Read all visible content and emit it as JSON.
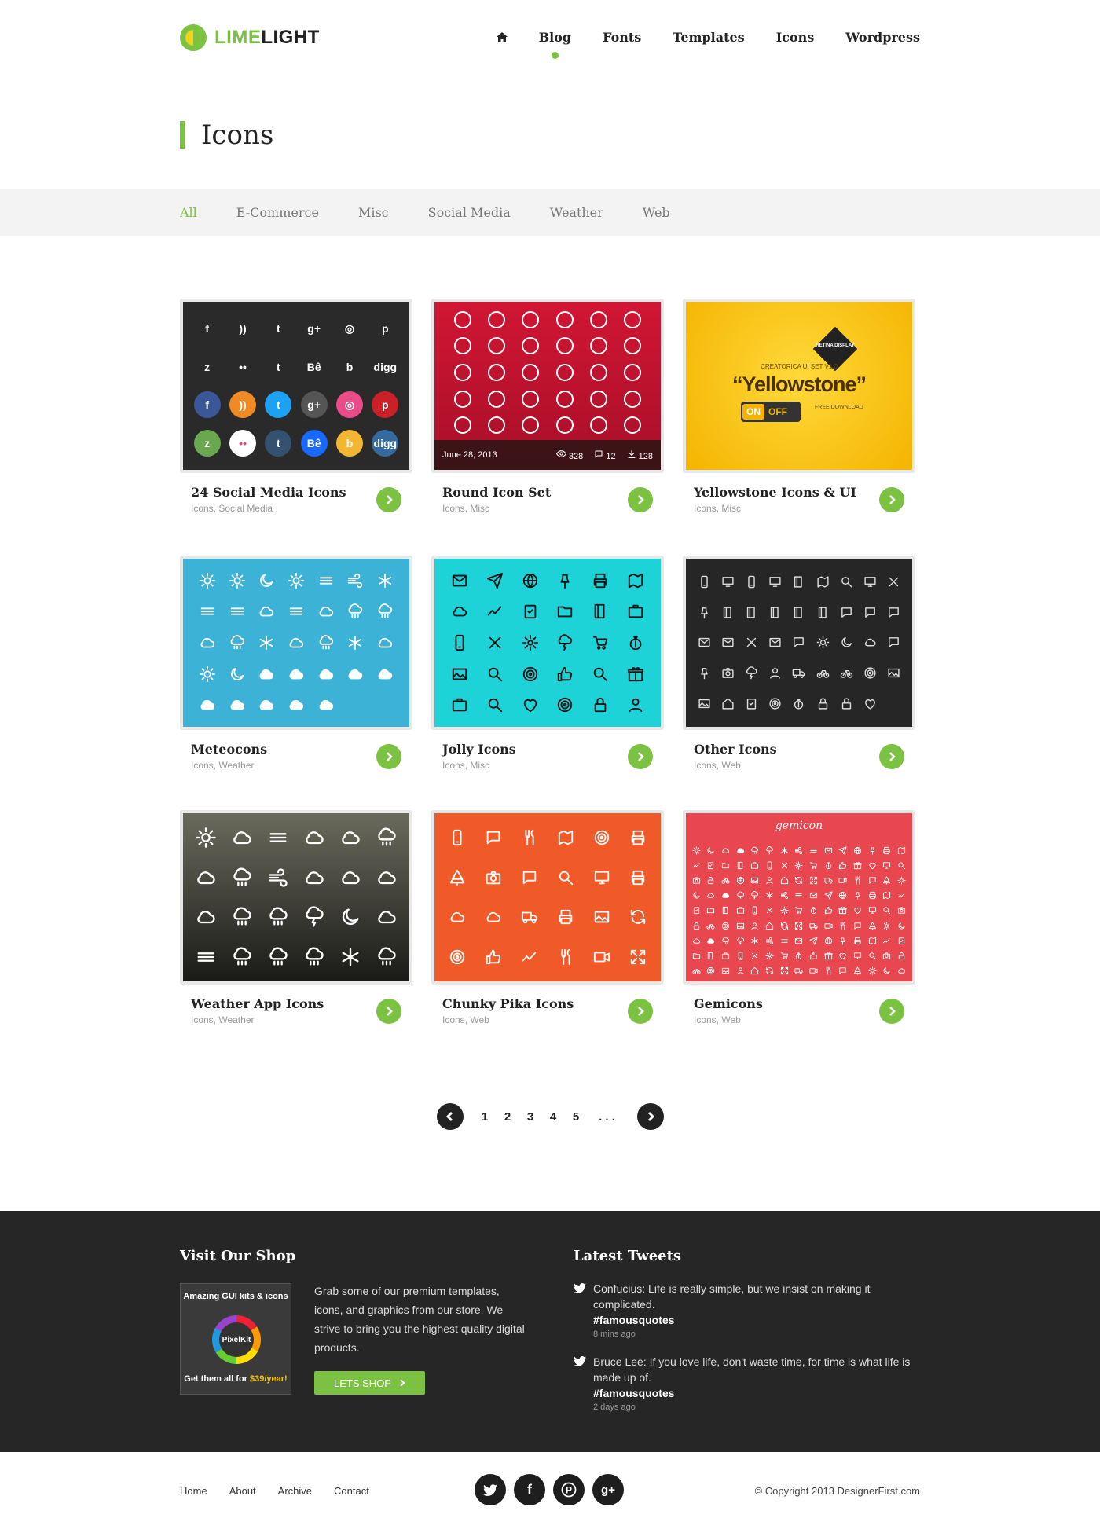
{
  "brand": {
    "part1": "LIME",
    "part2": "LIGHT",
    "accent": "#7cc242"
  },
  "nav": {
    "items": [
      "Blog",
      "Fonts",
      "Templates",
      "Icons",
      "Wordpress"
    ],
    "active": "Blog",
    "home_icon": "home-icon"
  },
  "page": {
    "title": "Icons"
  },
  "filters": {
    "items": [
      "All",
      "E-Commerce",
      "Misc",
      "Social Media",
      "Weather",
      "Web"
    ],
    "active": "All"
  },
  "cards": [
    {
      "title": "24 Social Media Icons",
      "tags": "Icons, Social Media",
      "bg": "#2a2a2a"
    },
    {
      "title": "Round Icon Set",
      "tags": "Icons, Misc",
      "bg": "#c5102c",
      "meta": {
        "date": "June 28, 2013",
        "views": "328",
        "comments": "12",
        "downloads": "128"
      }
    },
    {
      "title": "Yellowstone Icons & UI",
      "tags": "Icons, Misc",
      "bg": "#fcc300",
      "banner": {
        "pre": "CREATORICA UI SET V1.0",
        "name": "“Yellowstone”",
        "badge": "RETINA DISPLAY",
        "toggle_on": "ON",
        "toggle_off": "OFF",
        "free": "FREE DOWNLOAD"
      }
    },
    {
      "title": "Meteocons",
      "tags": "Icons, Weather",
      "bg": "#3bb2d6"
    },
    {
      "title": "Jolly Icons",
      "tags": "Icons, Misc",
      "bg": "#1ed3d8"
    },
    {
      "title": "Other Icons",
      "tags": "Icons, Web",
      "bg": "#262626"
    },
    {
      "title": "Weather App Icons",
      "tags": "Icons, Weather",
      "bg": "#3a3a34"
    },
    {
      "title": "Chunky Pika Icons",
      "tags": "Icons, Web",
      "bg": "#f05a28"
    },
    {
      "title": "Gemicons",
      "tags": "Icons, Web",
      "bg": "#e8474f",
      "logo": "gemicon"
    }
  ],
  "pagination": {
    "pages": [
      "1",
      "2",
      "3",
      "4",
      "5"
    ],
    "ellipsis": ". . ."
  },
  "footer": {
    "shop": {
      "heading": "Visit Our Shop",
      "img_top": "Amazing GUI kits & icons",
      "img_center": "PixelKit",
      "img_bottom_pre": "Get them all for ",
      "img_bottom_price": "$39/year!",
      "text": "Grab some of our premium templates, icons, and graphics from our store. We strive to bring you the highest quality digital products.",
      "button": "LETS SHOP"
    },
    "tweets": {
      "heading": "Latest Tweets",
      "items": [
        {
          "text": "Confucius: Life is really simple, but we insist on making it complicated.",
          "tag": "#famousquotes",
          "time": "8 mins ago"
        },
        {
          "text": "Bruce Lee: If you love life, don't waste time, for time is what life is made up of.",
          "tag": "#famousquotes",
          "time": "2 days ago"
        }
      ]
    }
  },
  "bottom": {
    "links": [
      "Home",
      "About",
      "Archive",
      "Contact"
    ],
    "social": [
      "twitter-icon",
      "facebook-icon",
      "pinterest-icon",
      "google-plus-icon"
    ],
    "copyright": "© Copyright 2013 DesignerFirst.com"
  }
}
